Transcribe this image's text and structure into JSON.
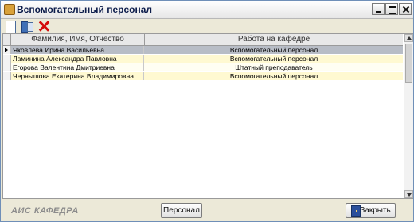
{
  "window": {
    "title": "Вспомогательный персонал",
    "icon": "folder-icon",
    "controls": [
      "minimize",
      "maximize",
      "close"
    ]
  },
  "toolbar": {
    "items": [
      {
        "name": "new-icon",
        "label": ""
      },
      {
        "name": "edit-icon",
        "label": ""
      },
      {
        "name": "delete-icon",
        "label": ""
      }
    ]
  },
  "grid": {
    "columns": [
      "Фамилия, Имя, Отчество",
      "Работа на кафедре"
    ],
    "rows": [
      {
        "name": "Яковлева Ирина Васильевна",
        "work": "Вспомогательный персонал"
      },
      {
        "name": "Ламинина Александра Павловна",
        "work": "Вспомогательный персонал"
      },
      {
        "name": "Егорова Валентина Дмитриевна",
        "work": "Штатный преподаватель"
      },
      {
        "name": "Чернышова Екатерина Владимировна",
        "work": "Вспомогательный персонал"
      }
    ],
    "selected_index": 0
  },
  "footer": {
    "company": "АИС КАФЕДРА",
    "staff_button": "Персонал",
    "close_button": "Закрыть"
  },
  "colors": {
    "selected_row": "#b8bdc6",
    "alt_row": "#fff9d1",
    "title_text": "#0b1b4a"
  }
}
